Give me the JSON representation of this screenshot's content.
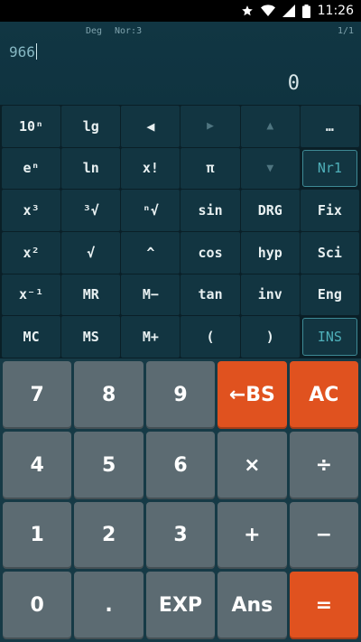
{
  "status_bar": {
    "time": "11:26",
    "icons": [
      "star-icon",
      "wifi-icon",
      "signal-icon",
      "battery-icon"
    ]
  },
  "display": {
    "angle_mode": "Deg",
    "format_mode": "Nor:3",
    "page": "1/1",
    "expression": "966",
    "result": "0"
  },
  "function_keys": [
    [
      "10ⁿ",
      "lg",
      "◀",
      "▶",
      "▲",
      "…"
    ],
    [
      "eⁿ",
      "ln",
      "x!",
      "π",
      "▼",
      "Nr1"
    ],
    [
      "x³",
      "³√",
      "ⁿ√",
      "sin",
      "DRG",
      "Fix"
    ],
    [
      "x²",
      "√",
      "^",
      "cos",
      "hyp",
      "Sci"
    ],
    [
      "x⁻¹",
      "MR",
      "M−",
      "tan",
      "inv",
      "Eng"
    ],
    [
      "MC",
      "MS",
      "M+",
      "(",
      ")",
      "INS"
    ]
  ],
  "number_keys": [
    [
      "7",
      "8",
      "9",
      "←BS",
      "AC"
    ],
    [
      "4",
      "5",
      "6",
      "×",
      "÷"
    ],
    [
      "1",
      "2",
      "3",
      "+",
      "−"
    ],
    [
      "0",
      ".",
      "EXP",
      "Ans",
      "="
    ]
  ],
  "colors": {
    "accent": "#e0521f",
    "numpad_key": "#5c6b72",
    "function_key": "#123541",
    "outline": "#3e8a95"
  }
}
